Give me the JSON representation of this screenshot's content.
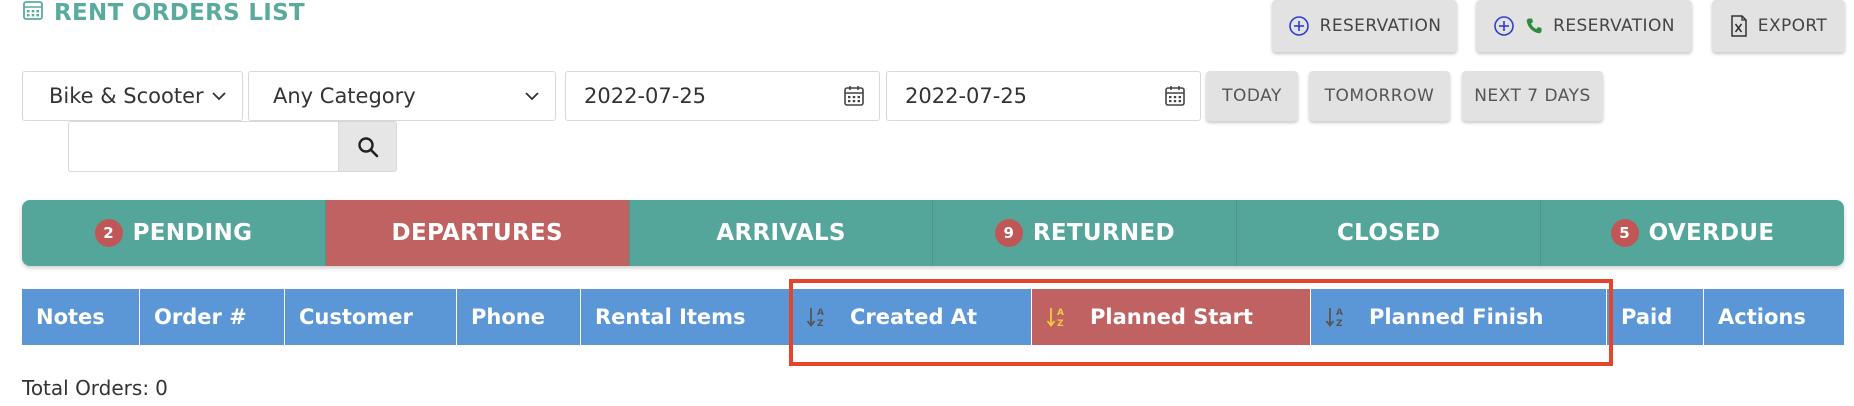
{
  "page": {
    "title": "RENT ORDERS LIST"
  },
  "toolbar": {
    "reservation_label": "RESERVATION",
    "phone_reservation_label": "RESERVATION",
    "export_label": "EXPORT"
  },
  "filters": {
    "vehicle_type": "Bike & Scooter",
    "category": "Any Category",
    "date_from": "2022-07-25",
    "date_to": "2022-07-25",
    "quick": {
      "today": "TODAY",
      "tomorrow": "TOMORROW",
      "next7": "NEXT 7 DAYS"
    },
    "search_value": ""
  },
  "tabs": [
    {
      "label": "PENDING",
      "count": "2"
    },
    {
      "label": "DEPARTURES",
      "count": ""
    },
    {
      "label": "ARRIVALS",
      "count": ""
    },
    {
      "label": "RETURNED",
      "count": "9"
    },
    {
      "label": "CLOSED",
      "count": ""
    },
    {
      "label": "OVERDUE",
      "count": "5"
    }
  ],
  "table": {
    "columns": [
      "Notes",
      "Order #",
      "Customer",
      "Phone",
      "Rental Items",
      "Created At",
      "Planned Start",
      "Planned Finish",
      "Paid",
      "Actions"
    ]
  },
  "summary": {
    "total_label": "Total Orders:",
    "total_value": "0"
  },
  "colors": {
    "teal": "#55a69a",
    "red_active": "#c06262",
    "header_blue": "#5b96d6",
    "highlight": "#e4452c"
  },
  "icons": [
    "calendar-icon",
    "plus-circle-icon",
    "phone-icon",
    "excel-file-icon",
    "chevron-down-icon",
    "search-icon",
    "sort-az-icon"
  ]
}
